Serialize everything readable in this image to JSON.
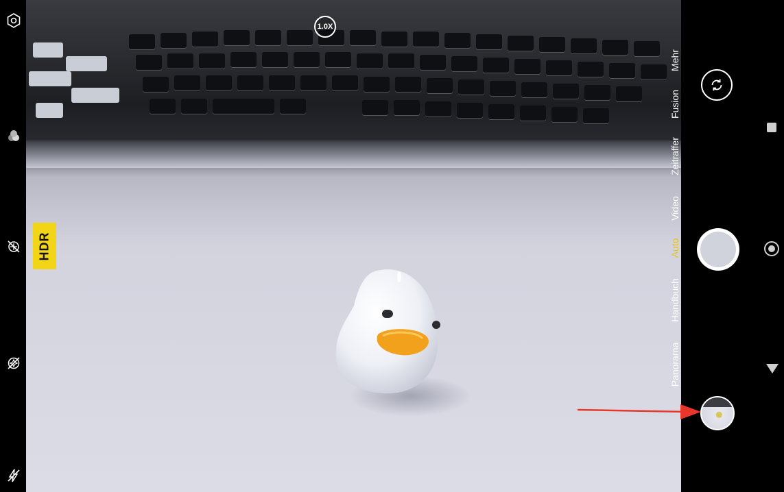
{
  "left_rail": {
    "icons": [
      "settings-icon",
      "filter-icon",
      "hdr-off-icon",
      "ai-off-icon",
      "flash-off-icon"
    ]
  },
  "viewfinder": {
    "hdr_label": "HDR",
    "zoom_label": "1.0X"
  },
  "modes": [
    {
      "label": "Mehr",
      "active": false
    },
    {
      "label": "Fusion",
      "active": false
    },
    {
      "label": "Zeitraffer",
      "active": false
    },
    {
      "label": "Video",
      "active": false
    },
    {
      "label": "Auto",
      "active": true
    },
    {
      "label": "Handbuch",
      "active": false
    },
    {
      "label": "Panorama",
      "active": false
    }
  ],
  "controls": {
    "switch_camera_icon": "camera-switch-icon",
    "shutter_icon": "shutter-button",
    "gallery_icon": "gallery-thumbnail"
  },
  "nav_bar": {
    "icons": [
      "recent-apps-icon",
      "home-icon",
      "back-icon"
    ]
  },
  "colors": {
    "accent_active_mode": "#e6c21d",
    "hdr_badge": "#f2d516",
    "annotation_arrow": "#e8372a"
  }
}
